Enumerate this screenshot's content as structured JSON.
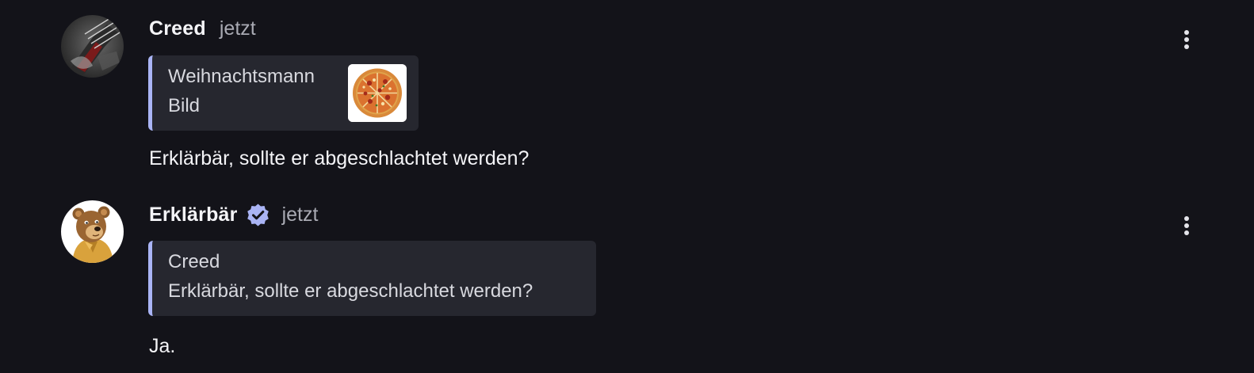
{
  "colors": {
    "background": "#131319",
    "quote_background": "#26272f",
    "quote_accent": "#aab4f5",
    "verified_badge": "#aab4f5",
    "timestamp": "#a9aab3"
  },
  "messages": [
    {
      "author": "Creed",
      "time": "jetzt",
      "avatar_icon": "guitar-avatar",
      "verified": false,
      "quote": {
        "author": "Weihnachtsmann",
        "text": "Bild",
        "thumbnail_icon": "pizza-image"
      },
      "text": "Erklärbär, sollte er abgeschlachtet werden?",
      "menu_icon": "more-vertical-icon"
    },
    {
      "author": "Erklärbär",
      "time": "jetzt",
      "avatar_icon": "bear-avatar",
      "verified": true,
      "verified_icon": "verified-badge-icon",
      "quote": {
        "author": "Creed",
        "text": "Erklärbär, sollte er abgeschlachtet werden?"
      },
      "text": "Ja.",
      "menu_icon": "more-vertical-icon"
    }
  ]
}
